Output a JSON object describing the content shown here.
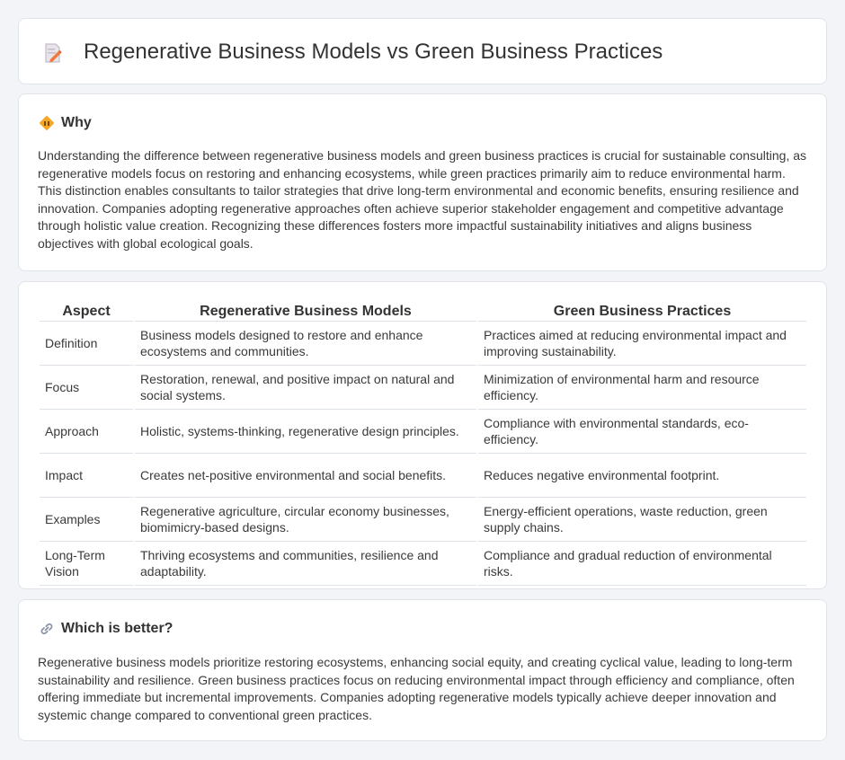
{
  "header": {
    "title": "Regenerative Business Models vs Green Business Practices",
    "icon": "document-pencil-icon"
  },
  "why": {
    "heading": "Why",
    "icon": "diamond-sign-icon",
    "body": "Understanding the difference between regenerative business models and green business practices is crucial for sustainable consulting, as regenerative models focus on restoring and enhancing ecosystems, while green practices primarily aim to reduce environmental harm. This distinction enables consultants to tailor strategies that drive long-term environmental and economic benefits, ensuring resilience and innovation. Companies adopting regenerative approaches often achieve superior stakeholder engagement and competitive advantage through holistic value creation. Recognizing these differences fosters more impactful sustainability initiatives and aligns business objectives with global ecological goals."
  },
  "table": {
    "headers": [
      "Aspect",
      "Regenerative Business Models",
      "Green Business Practices"
    ],
    "rows": [
      [
        "Definition",
        "Business models designed to restore and enhance ecosystems and communities.",
        "Practices aimed at reducing environmental impact and improving sustainability."
      ],
      [
        "Focus",
        "Restoration, renewal, and positive impact on natural and social systems.",
        "Minimization of environmental harm and resource efficiency."
      ],
      [
        "Approach",
        "Holistic, systems-thinking, regenerative design principles.",
        "Compliance with environmental standards, eco-efficiency."
      ],
      [
        "Impact",
        "Creates net-positive environmental and social benefits.",
        "Reduces negative environmental footprint."
      ],
      [
        "Examples",
        "Regenerative agriculture, circular economy businesses, biomimicry-based designs.",
        "Energy-efficient operations, waste reduction, green supply chains."
      ],
      [
        "Long-Term Vision",
        "Thriving ecosystems and communities, resilience and adaptability.",
        "Compliance and gradual reduction of environmental risks."
      ]
    ]
  },
  "better": {
    "heading": "Which is better?",
    "icon": "link-icon",
    "body": "Regenerative business models prioritize restoring ecosystems, enhancing social equity, and creating cyclical value, leading to long-term sustainability and resilience. Green business practices focus on reducing environmental impact through efficiency and compliance, often offering immediate but incremental improvements. Companies adopting regenerative models typically achieve deeper innovation and systemic change compared to conventional green practices."
  }
}
